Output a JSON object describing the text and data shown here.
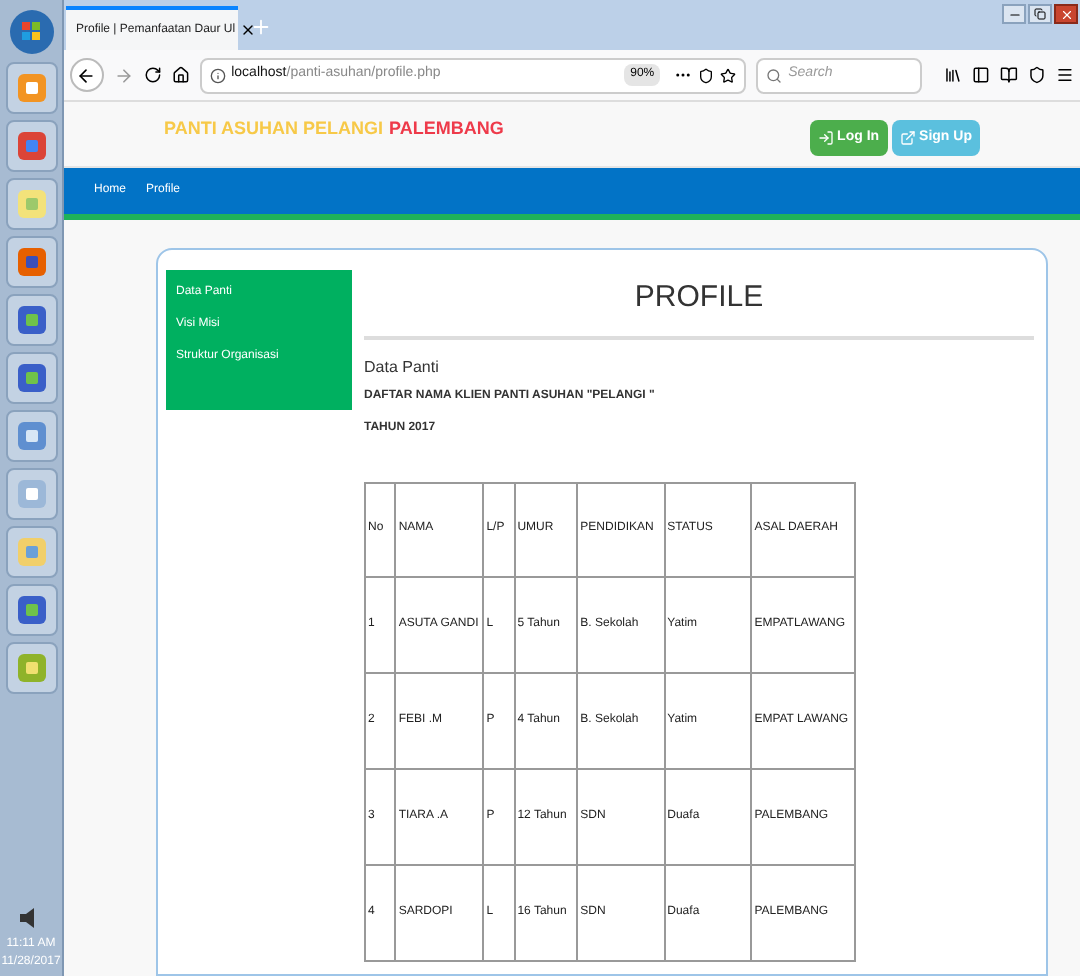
{
  "taskbar": {
    "time": "11:11 AM",
    "date": "11/28/2017"
  },
  "browser": {
    "tab_title": "Profile | Pemanfaatan Daur Ul",
    "address_host": "localhost",
    "address_path": "/panti-asuhan/profile.php",
    "zoom": "90%",
    "search": {
      "placeholder": "Search"
    }
  },
  "site_header": {
    "brand": "PANTI ASUHAN PELANGI",
    "brand_city": "PALEMBANG",
    "buttons": [
      {
        "label": "Log In",
        "kind": "login"
      },
      {
        "label": "Sign Up",
        "kind": "signup"
      }
    ]
  },
  "nav": {
    "items": [
      "Home",
      "Profile"
    ]
  },
  "sidebar": {
    "items": [
      "Data Panti",
      "Visi Misi",
      "Struktur Organisasi"
    ]
  },
  "main": {
    "title": "PROFILE",
    "subtitle": "Data Panti",
    "heading": "DAFTAR NAMA KLIEN PANTI ASUHAN \"PELANGI \"",
    "year": "TAHUN 2017",
    "table": {
      "columns": [
        "No",
        "NAMA",
        "L/P",
        "UMUR",
        "PENDIDIKAN",
        "STATUS",
        "ASAL DAERAH"
      ],
      "rows": [
        [
          "1",
          "ASUTA GANDI",
          "L",
          "5 Tahun",
          "B. Sekolah",
          "Yatim",
          "EMPATLAWANG"
        ],
        [
          "2",
          "FEBI .M",
          "P",
          "4  Tahun",
          "B. Sekolah",
          "Yatim",
          "EMPAT LAWANG"
        ],
        [
          "3",
          "TIARA .A",
          "P",
          "12  Tahun",
          "SDN",
          "Duafa",
          "PALEMBANG"
        ],
        [
          "4",
          "SARDOPI",
          "L",
          "16  Tahun",
          "SDN",
          "Duafa",
          "PALEMBANG"
        ]
      ]
    }
  }
}
